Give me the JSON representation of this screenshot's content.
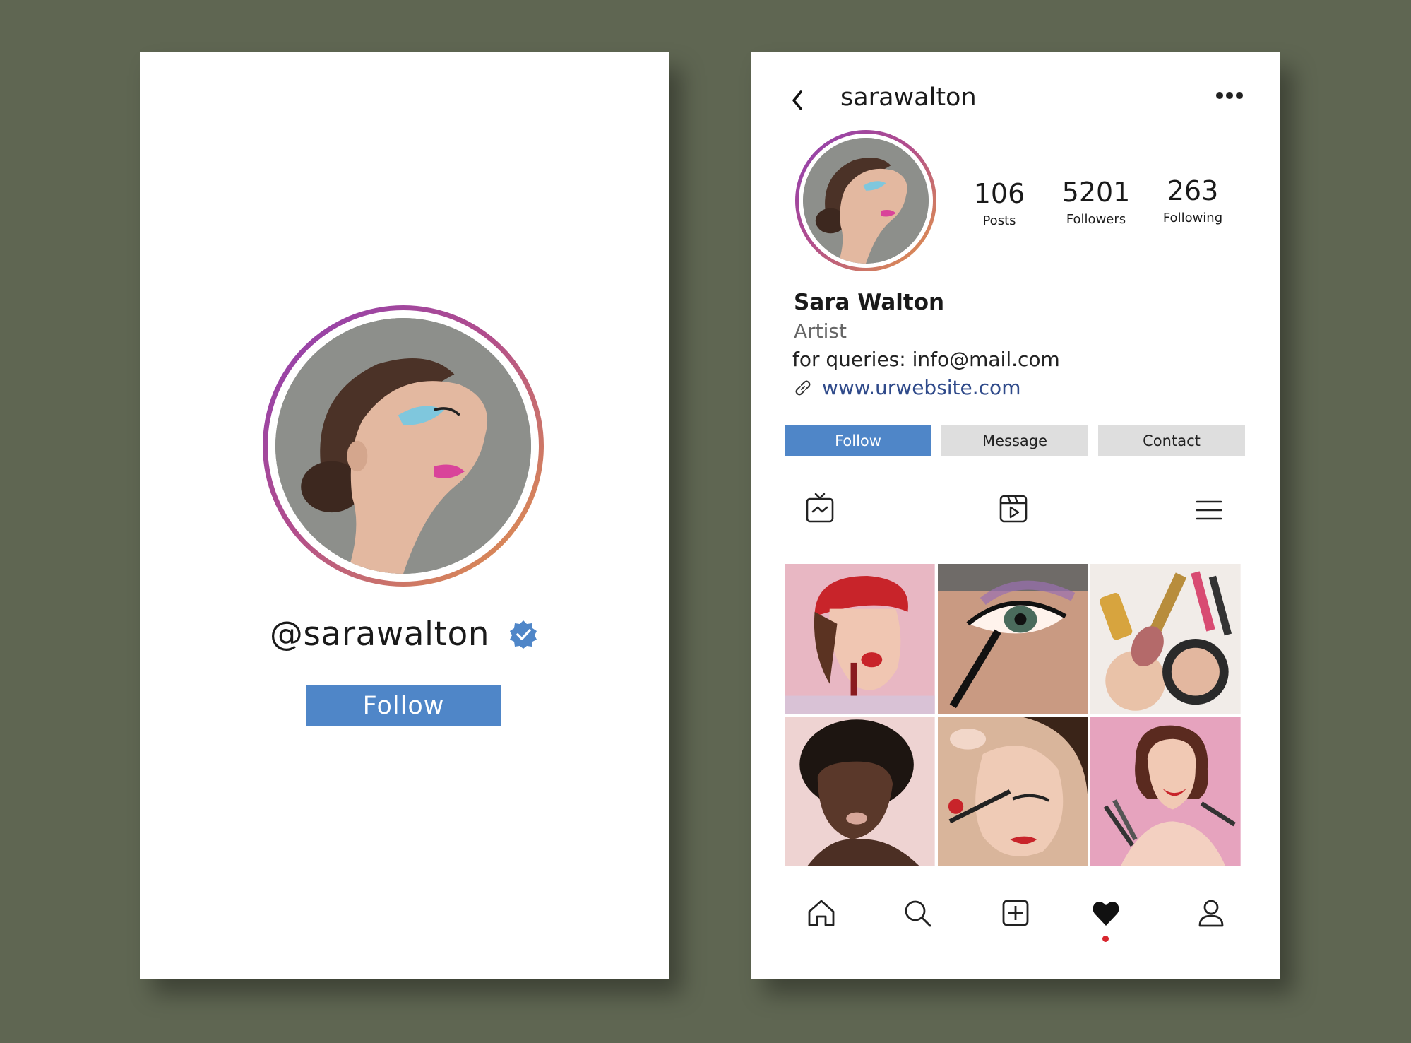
{
  "left_screen": {
    "handle": "@sarawalton",
    "follow_label": "Follow"
  },
  "right_screen": {
    "header": {
      "username": "sarawalton"
    },
    "stats": [
      {
        "value": "106",
        "label": "Posts"
      },
      {
        "value": "5201",
        "label": "Followers"
      },
      {
        "value": "263",
        "label": "Following"
      }
    ],
    "bio": {
      "name": "Sara Walton",
      "role": "Artist",
      "contact": "for queries: info@mail.com",
      "website": "www.urwebsite.com"
    },
    "actions": {
      "follow": "Follow",
      "message": "Message",
      "contact": "Contact"
    },
    "tabs": [
      "igtv-icon",
      "reels-icon",
      "list-icon"
    ],
    "grid_photos": [
      "photo-woman-red-beret-lipstick",
      "photo-mascara-closeup",
      "photo-makeup-products",
      "photo-woman-afro",
      "photo-eyeliner-application",
      "photo-woman-makeup-brushes"
    ],
    "bottom_nav": [
      "home-icon",
      "search-icon",
      "add-post-icon",
      "heart-icon",
      "profile-icon"
    ]
  },
  "colors": {
    "background": "#5f6652",
    "accent_blue": "#4f86c8",
    "ring_gradient": [
      "#8e3fb2",
      "#e59a46"
    ],
    "link": "#2f4a8a",
    "notification_dot": "#d8262e"
  }
}
